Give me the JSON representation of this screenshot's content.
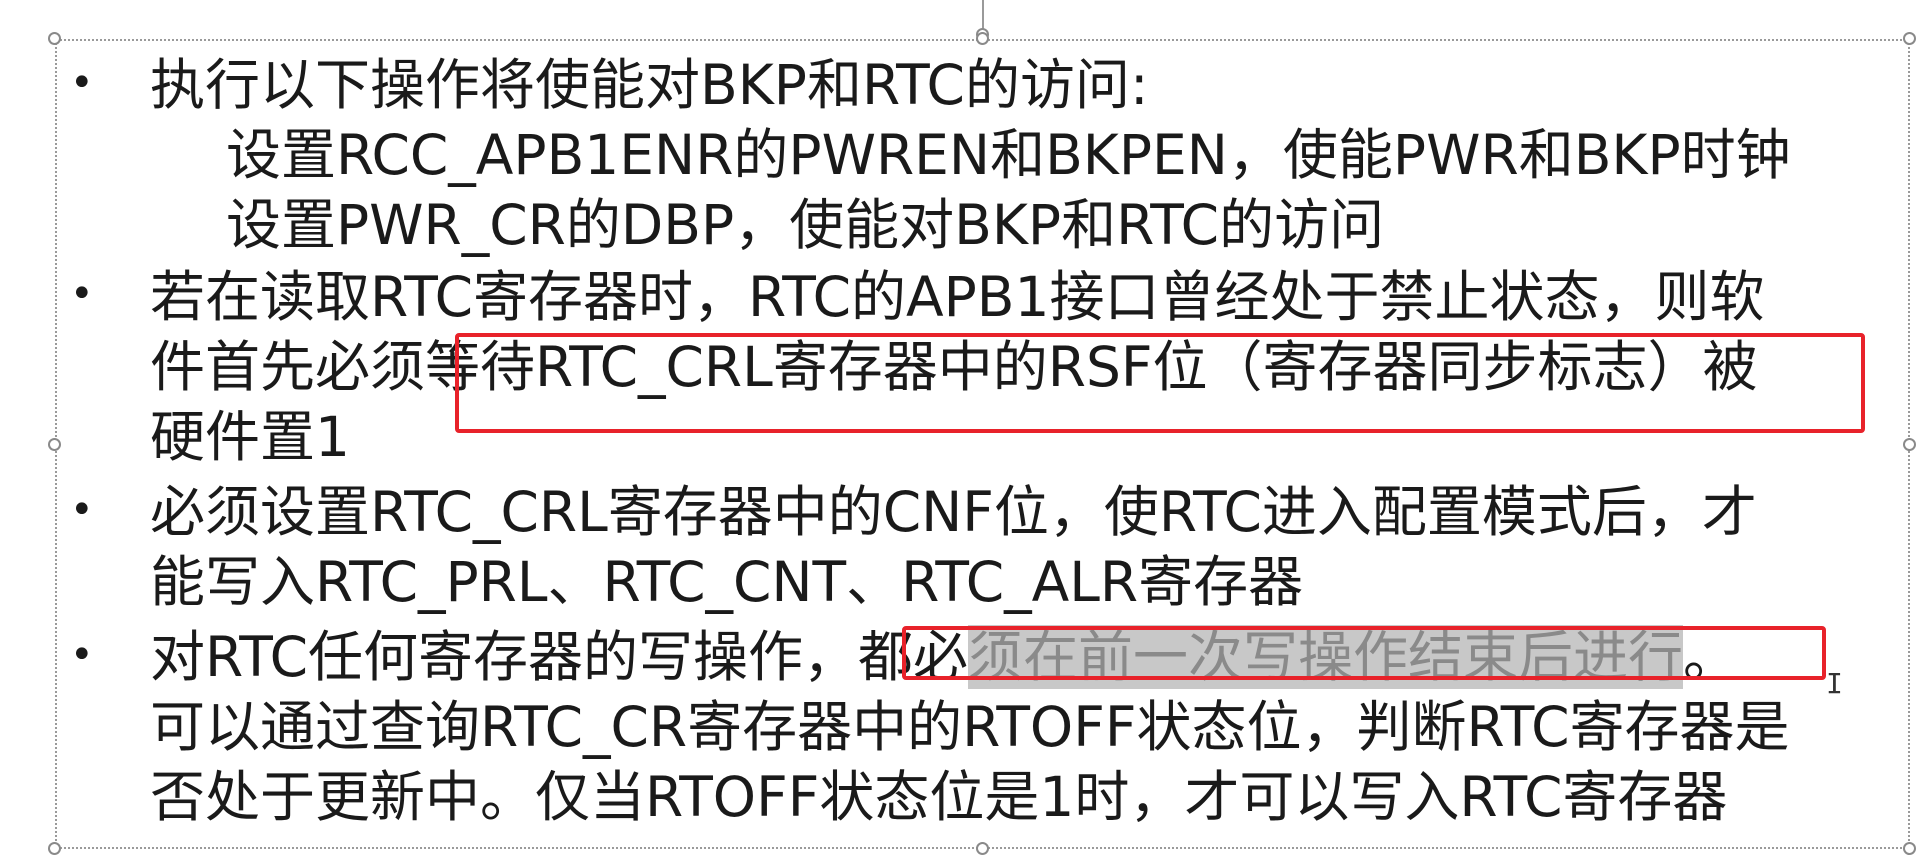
{
  "slide": {
    "bullets": [
      {
        "glyph": "•",
        "lines": [
          "执行以下操作将使能对BKP和RTC的访问:"
        ]
      },
      {
        "glyph": "",
        "lines": [
          "设置RCC_APB1ENR的PWREN和BKPEN，使能PWR和BKP时钟"
        ]
      },
      {
        "glyph": "",
        "lines": [
          "设置PWR_CR的DBP，使能对BKP和RTC的访问"
        ]
      },
      {
        "glyph": "•",
        "lines": [
          "若在读取RTC寄存器时，RTC的APB1接口曾经处于禁止状态，则软",
          "件首先必须等待RTC_CRL寄存器中的RSF位（寄存器同步标志）被",
          "硬件置1"
        ]
      },
      {
        "glyph": "•",
        "lines": [
          "必须设置RTC_CRL寄存器中的CNF位，使RTC进入配置模式后，才",
          "能写入RTC_PRL、RTC_CNT、RTC_ALR寄存器"
        ]
      },
      {
        "glyph": "•",
        "line_parts": {
          "before": "对RTC任何寄存器的写操作，都必",
          "selected": "须在前一次写操作结束后进行",
          "after": "。"
        },
        "lines": [
          "可以通过查询RTC_CR寄存器中的RTOFF状态位，判断RTC寄存器是",
          "否处于更新中。仅当RTOFF状态位是1时，才可以写入RTC寄存器"
        ]
      }
    ]
  },
  "colors": {
    "text": "#1a1a1a",
    "annotation_red": "#e8222a",
    "selection_bg": "#c8c8c8",
    "frame": "#9a9a9a"
  }
}
